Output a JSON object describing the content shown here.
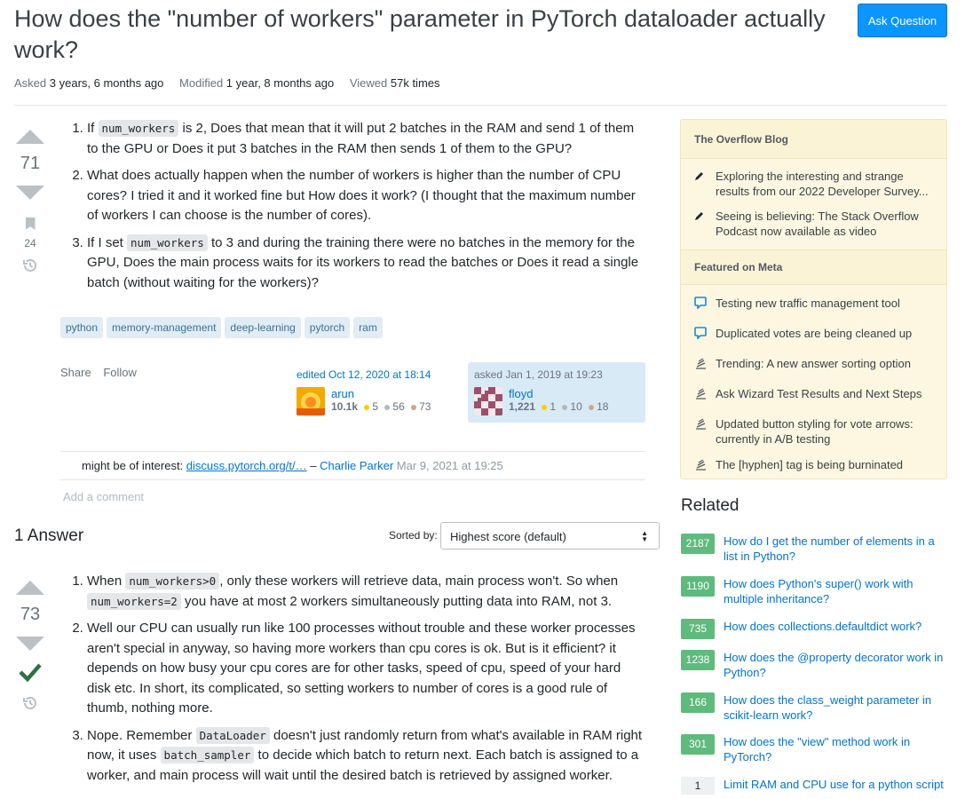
{
  "question": {
    "title": "How does the \"number of workers\" parameter in PyTorch dataloader actually work?",
    "ask_button": "Ask Question",
    "asked_label": "Asked",
    "asked_value": "3 years, 6 months ago",
    "modified_label": "Modified",
    "modified_value": "1 year, 8 months ago",
    "viewed_label": "Viewed",
    "viewed_value": "57k times",
    "score": "71",
    "bookmarks": "24",
    "items": [
      {
        "p1": "If ",
        "code1": "num_workers",
        "p2": " is 2, Does that mean that it will put 2 batches in the RAM and send 1 of them to the GPU or Does it put 3 batches in the RAM then sends 1 of them to the GPU?"
      },
      {
        "p1": "What does actually happen when the number of workers is higher than the number of CPU cores? I tried it and it worked fine but How does it work? (I thought that the maximum number of workers I can choose is the number of cores)."
      },
      {
        "p1": "If I set ",
        "code1": "num_workers",
        "p2": " to 3 and during the training there were no batches in the memory for the GPU, Does the main process waits for its workers to read the batches or Does it read a single batch (without waiting for the workers)?"
      }
    ],
    "tags": [
      "python",
      "memory-management",
      "deep-learning",
      "pytorch",
      "ram"
    ],
    "share": "Share",
    "follow": "Follow",
    "edited": {
      "action": "edited Oct 12, 2020 at 18:14",
      "user": "arun",
      "rep": "10.1k",
      "gold": "5",
      "silver": "56",
      "bronze": "73"
    },
    "asked": {
      "action": "asked Jan 1, 2019 at 19:23",
      "user": "floyd",
      "rep": "1,221",
      "gold": "1",
      "silver": "10",
      "bronze": "18"
    },
    "comment": {
      "text": "might be of interest: ",
      "link": "discuss.pytorch.org/t/…",
      "sep": " – ",
      "user": "Charlie Parker",
      "date": "Mar 9, 2021 at 19:25"
    },
    "add_comment": "Add a comment"
  },
  "answers": {
    "header": "1 Answer",
    "sorted_label": "Sorted by:",
    "sorted_value": "Highest score (default)",
    "score": "73",
    "items": [
      {
        "p1": "When ",
        "code1": "num_workers>0",
        "p2": ", only these workers will retrieve data, main process won't. So when ",
        "code2": "num_workers=2",
        "p3": " you have at most 2 workers simultaneously putting data into RAM, not 3."
      },
      {
        "p1": "Well our CPU can usually run like 100 processes without trouble and these worker processes aren't special in anyway, so having more workers than cpu cores is ok. But is it efficient? it depends on how busy your cpu cores are for other tasks, speed of cpu, speed of your hard disk etc. In short, its complicated, so setting workers to number of cores is a good rule of thumb, nothing more."
      },
      {
        "p1": "Nope. Remember ",
        "code1": "DataLoader",
        "p2": " doesn't just randomly return from what's available in RAM right now, it uses ",
        "code2": "batch_sampler",
        "p3": " to decide which batch to return next. Each batch is assigned to a worker, and main process will wait until the desired batch is retrieved by assigned worker."
      }
    ]
  },
  "sidebar": {
    "blog_title": "The Overflow Blog",
    "blog_items": [
      "Exploring the interesting and strange results from our 2022 Developer Survey...",
      "Seeing is believing: The Stack Overflow Podcast now available as video"
    ],
    "meta_title": "Featured on Meta",
    "meta_items": [
      "Testing new traffic management tool",
      "Duplicated votes are being cleaned up",
      "Trending: A new answer sorting option",
      "Ask Wizard Test Results and Next Steps",
      "Updated button styling for vote arrows: currently in A/B testing",
      "The [hyphen] tag is being burninated"
    ],
    "related_title": "Related",
    "related": [
      {
        "score": "2187",
        "title": "How do I get the number of elements in a list in Python?"
      },
      {
        "score": "1190",
        "title": "How does Python's super() work with multiple inheritance?"
      },
      {
        "score": "735",
        "title": "How does collections.defaultdict work?"
      },
      {
        "score": "1238",
        "title": "How does the @property decorator work in Python?"
      },
      {
        "score": "166",
        "title": "How does the class_weight parameter in scikit-learn work?"
      },
      {
        "score": "301",
        "title": "How does the \"view\" method work in PyTorch?"
      },
      {
        "score": "1",
        "title": "Limit RAM and CPU use for a python script"
      }
    ]
  },
  "colors": {
    "accent": "#0a95ff",
    "accepted": "#2f6f44",
    "tag_bg": "#e1ecf4",
    "sidebar_bg": "#fdf7e2"
  }
}
